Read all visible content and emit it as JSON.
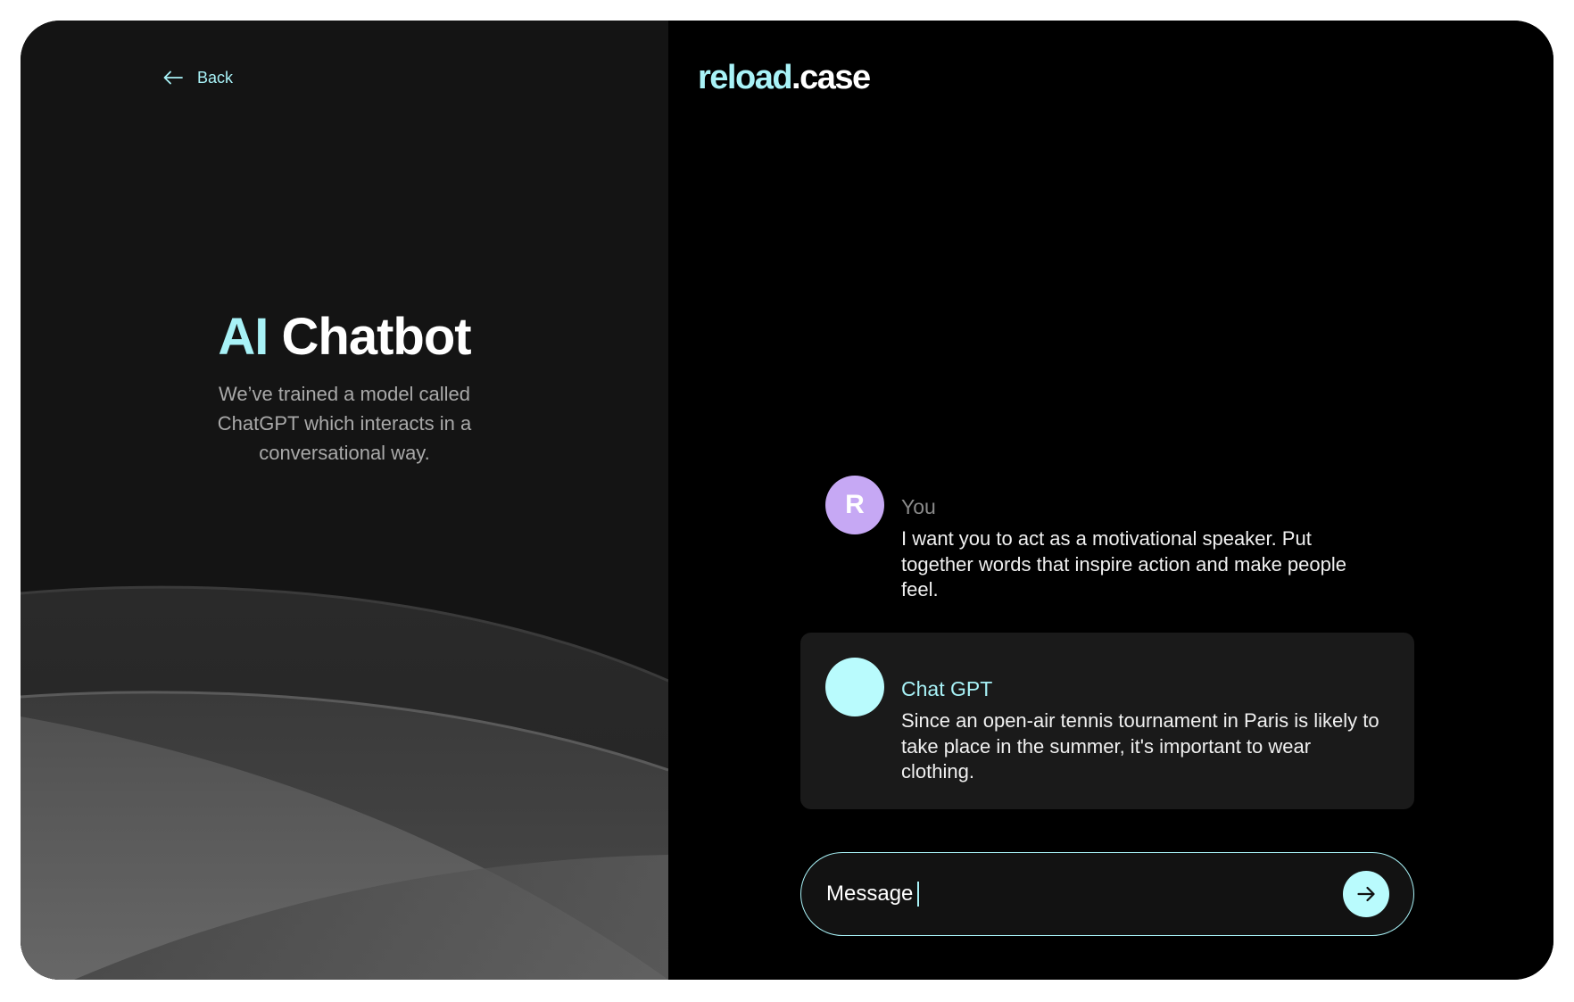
{
  "colors": {
    "accent": "#a8f2f7",
    "user_avatar": "#c6a8f4",
    "bot_avatar": "#b9fbfd",
    "left_panel_bg": "#141414",
    "right_panel_bg": "#000000",
    "bot_bubble_bg": "#1a1a1a"
  },
  "nav": {
    "back_label": "Back",
    "back_icon": "arrow-left-icon"
  },
  "hero": {
    "title_accent": "AI",
    "title_rest": "Chatbot",
    "subtitle": "We’ve trained a model called ChatGPT which interacts in a conversational way."
  },
  "brand": {
    "logo_part1": "reload",
    "logo_part2": ".case"
  },
  "messages": [
    {
      "avatar_initial": "R",
      "name": "You",
      "text": "I want you to act as a motivational speaker. Put together words that inspire action and make people feel."
    },
    {
      "avatar_initial": "",
      "name": "Chat GPT",
      "text": "Since an open-air tennis tournament in Paris is likely to take place in the summer, it's important to wear clothing."
    }
  ],
  "composer": {
    "placeholder": "Message",
    "send_icon": "arrow-right-icon"
  }
}
